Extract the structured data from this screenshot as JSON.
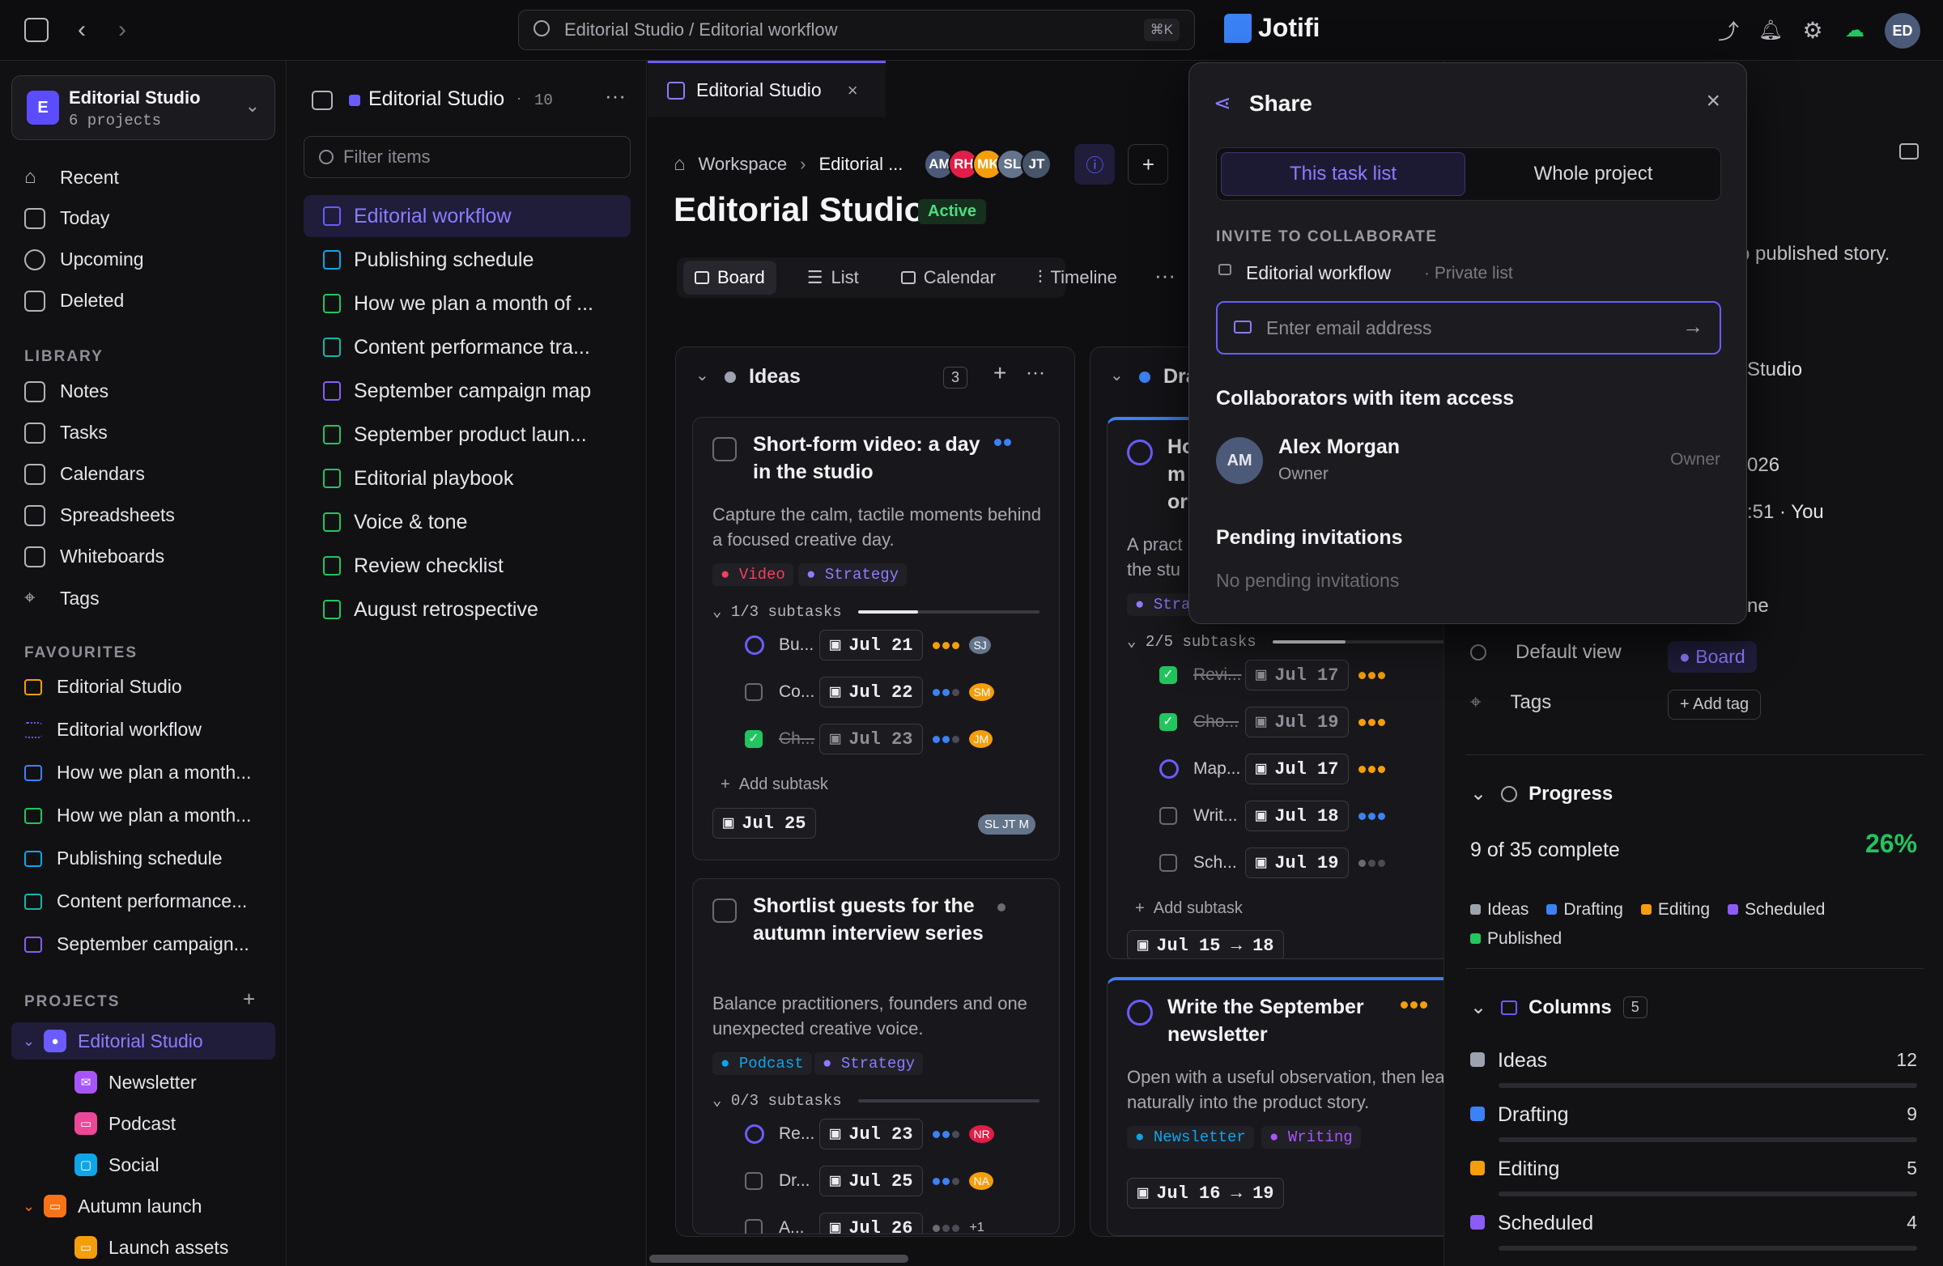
{
  "topbar": {
    "search": "Editorial Studio / Editorial workflow",
    "shortcut": "⌘K",
    "brand": "Jotifi",
    "user_initials": "ED"
  },
  "workspace": {
    "initial": "E",
    "name": "Editorial Studio",
    "sub": "6 projects"
  },
  "nav": [
    "Recent",
    "Today",
    "Upcoming",
    "Deleted"
  ],
  "library": {
    "title": "LIBRARY",
    "items": [
      "Notes",
      "Tasks",
      "Calendars",
      "Spreadsheets",
      "Whiteboards",
      "Tags"
    ]
  },
  "favourites": {
    "title": "FAVOURITES",
    "items": [
      "Editorial Studio",
      "Editorial workflow",
      "How we plan a month...",
      "How we plan a month...",
      "Publishing schedule",
      "Content performance...",
      "September campaign..."
    ]
  },
  "projects": {
    "title": "PROJECTS",
    "items": [
      "Editorial Studio",
      "Newsletter",
      "Podcast",
      "Social",
      "Autumn launch",
      "Launch assets"
    ]
  },
  "middle": {
    "title": "Editorial Studio",
    "count": "10",
    "filter_placeholder": "Filter items",
    "items": [
      "Editorial workflow",
      "Publishing schedule",
      "How we plan a month of ...",
      "Content performance tra...",
      "September campaign map",
      "September product laun...",
      "Editorial playbook",
      "Voice & tone",
      "Review checklist",
      "August retrospective"
    ]
  },
  "main": {
    "tab": "Editorial Studio",
    "crumb_root": "Workspace",
    "crumb_current": "Editorial ...",
    "avatars": [
      "AM",
      "RH",
      "MK",
      "SL",
      "JT"
    ],
    "title": "Editorial Studio",
    "status": "Active",
    "views": [
      "Board",
      "List",
      "Calendar",
      "Timeline"
    ]
  },
  "board": {
    "ideas": {
      "name": "Ideas",
      "count": "3",
      "card1": {
        "title": "Short-form video: a day in the studio",
        "desc": "Capture the calm, tactile moments behind a focused creative day.",
        "tags": [
          "Video",
          "Strategy"
        ],
        "subtasks": "1/3 subtasks",
        "progress": 0.33,
        "subs": [
          {
            "n": "Bu...",
            "d": "Jul 21"
          },
          {
            "n": "Co...",
            "d": "Jul 22"
          },
          {
            "n": "Ch...",
            "d": "Jul 23"
          }
        ],
        "add": "Add subtask",
        "due": "Jul 25"
      },
      "card2": {
        "title": "Shortlist guests for the autumn interview series",
        "desc": "Balance practitioners, founders and one unexpected creative voice.",
        "tags": [
          "Podcast",
          "Strategy"
        ],
        "subtasks": "0/3 subtasks",
        "progress": 0,
        "subs": [
          {
            "n": "Re...",
            "d": "Jul 23"
          },
          {
            "n": "Dr...",
            "d": "Jul 25"
          },
          {
            "n": "A...",
            "d": "Jul 26"
          }
        ],
        "more": "+1"
      }
    },
    "drafting": {
      "name": "Dra",
      "card1": {
        "title": [
          "Ho",
          "m",
          "or"
        ],
        "desc": [
          "A pract",
          "the stu"
        ],
        "tag": "Stra",
        "subtasks": "2/5 subtasks",
        "progress": 0.4,
        "subs": [
          {
            "n": "Revi...",
            "d": "Jul 17"
          },
          {
            "n": "Cho...",
            "d": "Jul 19"
          },
          {
            "n": "Map...",
            "d": "Jul 17"
          },
          {
            "n": "Writ...",
            "d": "Jul 18"
          },
          {
            "n": "Sch...",
            "d": "Jul 19"
          }
        ],
        "add": "Add subtask",
        "due": "Jul 15 → 18"
      },
      "card2": {
        "title": "Write the September newsletter",
        "desc": "Open with a useful observation, then lead naturally into the product story.",
        "tags": [
          "Newsletter",
          "Writing"
        ],
        "due": "Jul 16 → 19"
      }
    }
  },
  "share": {
    "title": "Share",
    "seg": [
      "This task list",
      "Whole project"
    ],
    "invite_title": "INVITE TO COLLABORATE",
    "list_name": "Editorial workflow",
    "list_privacy": "· Private list",
    "email_placeholder": "Enter email address",
    "collab_title": "Collaborators with item access",
    "person": {
      "initials": "AM",
      "name": "Alex Morgan",
      "role": "Owner",
      "access": "Owner"
    },
    "pending_title": "Pending invitations",
    "pending_empty": "No pending invitations"
  },
  "details": {
    "snippet1": "o published story.",
    "snippet2": "Studio",
    "snippet3": "026",
    "snippet4": ":51 · You",
    "snippet5": "ne",
    "default_view_label": "Default view",
    "default_view": "Board",
    "tags_label": "Tags",
    "add_tag": "Add tag",
    "progress": {
      "title": "Progress",
      "summary": "9 of 35 complete",
      "percent": "26%",
      "legend": [
        "Ideas",
        "Drafting",
        "Editing",
        "Scheduled",
        "Published"
      ]
    },
    "columns": {
      "title": "Columns",
      "count": "5",
      "rows": [
        {
          "name": "Ideas",
          "n": "12"
        },
        {
          "name": "Drafting",
          "n": "9"
        },
        {
          "name": "Editing",
          "n": "5"
        },
        {
          "name": "Scheduled",
          "n": "4"
        }
      ]
    }
  },
  "colors": {
    "accent": "#6a5cff",
    "ideas": "#9ca3af",
    "drafting": "#3b82f6",
    "editing": "#f59e0b",
    "scheduled": "#8b5cf6",
    "published": "#22c55e"
  }
}
